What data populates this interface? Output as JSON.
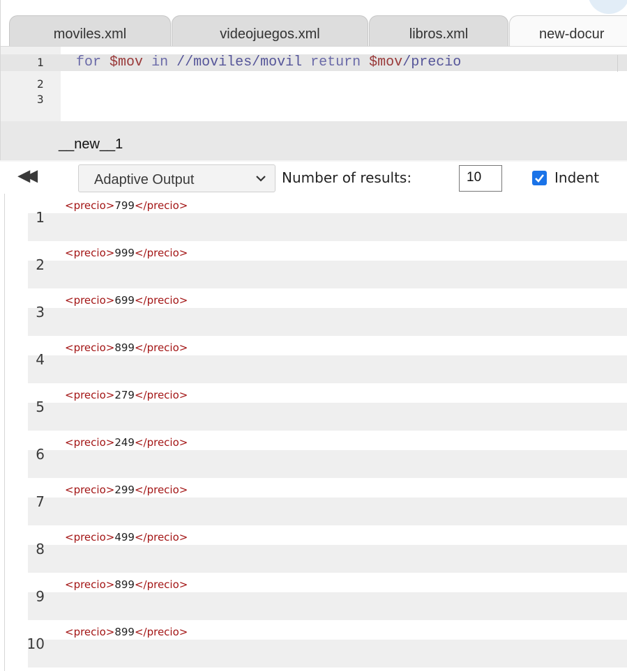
{
  "tabs": [
    {
      "label": "moviles.xml"
    },
    {
      "label": "videojuegos.xml"
    },
    {
      "label": "libros.xml"
    },
    {
      "label": "new-docur"
    }
  ],
  "editor": {
    "line_numbers": [
      "1",
      "2",
      "3"
    ],
    "code": {
      "kw_for": "for",
      "var1": "$mov",
      "kw_in": "in",
      "path": "//moviles/movil",
      "kw_return": "return",
      "var2": "$mov",
      "tail": "/precio"
    }
  },
  "output": {
    "name": "__new__1",
    "mode": "Adaptive Output",
    "num_results_label": "Number of results:",
    "num_results_value": "10",
    "indent_label": "Indent",
    "indent_checked": true
  },
  "results": [
    {
      "n": "1",
      "open": "<precio>",
      "value": "799",
      "close": "</precio>"
    },
    {
      "n": "2",
      "open": "<precio>",
      "value": "999",
      "close": "</precio>"
    },
    {
      "n": "3",
      "open": "<precio>",
      "value": "699",
      "close": "</precio>"
    },
    {
      "n": "4",
      "open": "<precio>",
      "value": "899",
      "close": "</precio>"
    },
    {
      "n": "5",
      "open": "<precio>",
      "value": "279",
      "close": "</precio>"
    },
    {
      "n": "6",
      "open": "<precio>",
      "value": "249",
      "close": "</precio>"
    },
    {
      "n": "7",
      "open": "<precio>",
      "value": "299",
      "close": "</precio>"
    },
    {
      "n": "8",
      "open": "<precio>",
      "value": "499",
      "close": "</precio>"
    },
    {
      "n": "9",
      "open": "<precio>",
      "value": "899",
      "close": "</precio>"
    },
    {
      "n": "10",
      "open": "<precio>",
      "value": "899",
      "close": "</precio>"
    }
  ],
  "colors": {
    "accent": "#1a73e8",
    "tag": "#a31515"
  },
  "icons": {
    "collapse": "double-left-arrow-icon",
    "dropdown": "chevron-down-icon",
    "checkbox": "checkmark-icon"
  }
}
